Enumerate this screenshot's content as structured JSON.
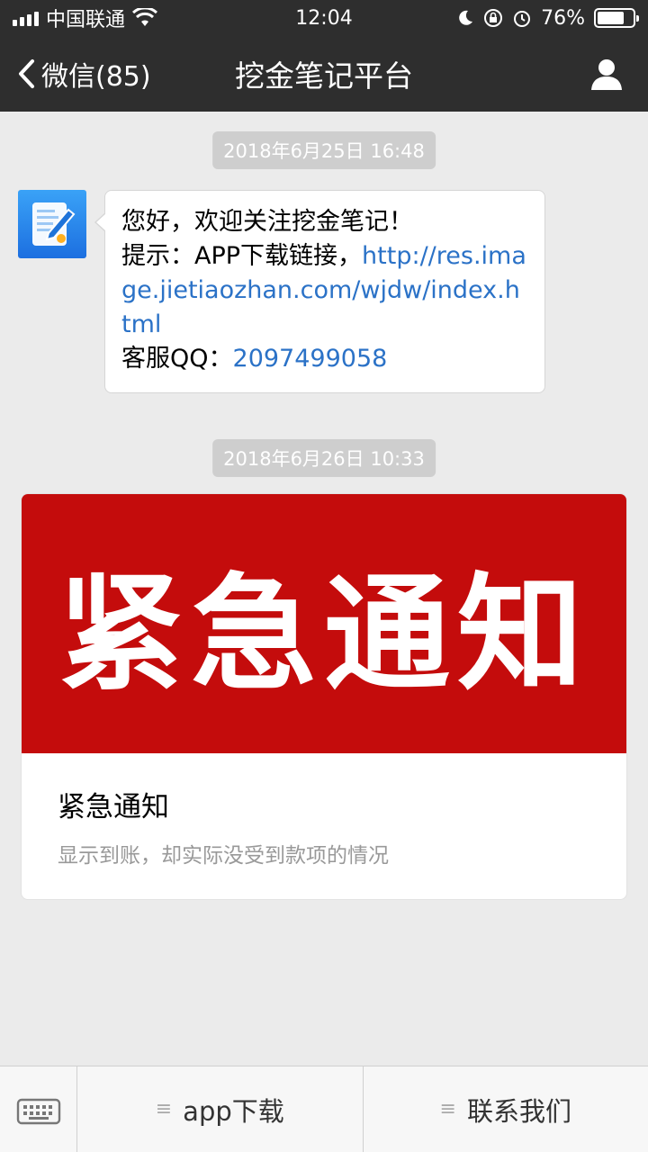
{
  "status_bar": {
    "carrier": "中国联通",
    "time": "12:04",
    "battery_text": "76%",
    "battery_level": 0.76
  },
  "nav": {
    "back_label": "微信(85)",
    "title": "挖金笔记平台"
  },
  "messages": [
    {
      "timestamp": "2018年6月25日 16:48",
      "line1": "您好，欢迎关注挖金笔记！",
      "line2_prefix": "提示：APP下载链接，",
      "link": "http://res.image.jietiaozhan.com/wjdw/index.html",
      "line3_prefix": "客服QQ：",
      "qq": "2097499058"
    },
    {
      "timestamp": "2018年6月26日 10:33",
      "card_banner": "紧急通知",
      "card_title": "紧急通知",
      "card_desc": "显示到账，却实际没受到款项的情况"
    }
  ],
  "menu": {
    "items": [
      {
        "label": "app下载",
        "icon": "≡"
      },
      {
        "label": "联系我们",
        "icon": "≡"
      }
    ]
  },
  "colors": {
    "header_bg": "#2e2e2e",
    "chat_bg": "#ebebeb",
    "banner_red": "#c40c0c",
    "link_blue": "#2b72c7"
  }
}
